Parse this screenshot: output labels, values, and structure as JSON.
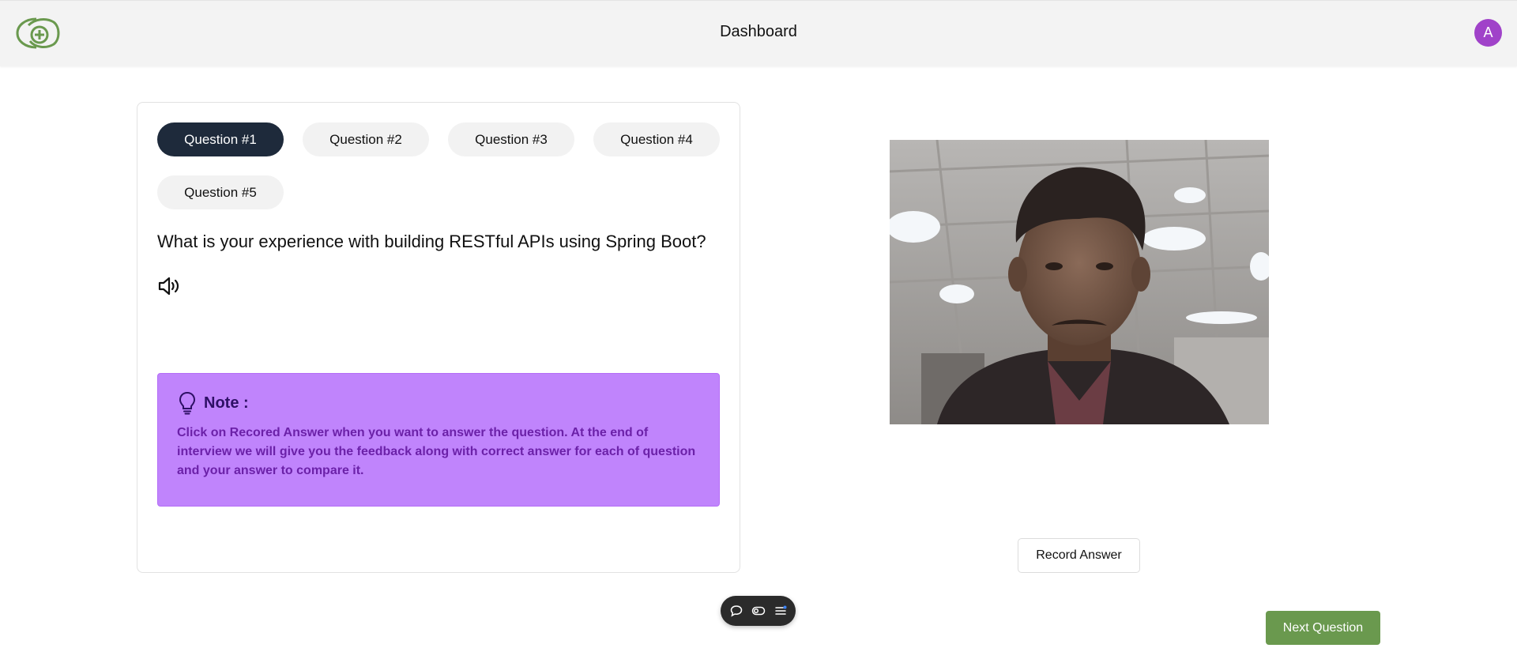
{
  "header": {
    "title": "Dashboard",
    "avatar_initial": "A",
    "logo_icon": "brand-logo",
    "colors": {
      "logo": "#6a994e",
      "avatar": "#a042c9"
    }
  },
  "question_tabs": [
    {
      "label": "Question #1",
      "active": true
    },
    {
      "label": "Question #2",
      "active": false
    },
    {
      "label": "Question #3",
      "active": false
    },
    {
      "label": "Question #4",
      "active": false
    },
    {
      "label": "Question #5",
      "active": false
    }
  ],
  "question": {
    "text": "What is your experience with building RESTful APIs using Spring Boot?",
    "speaker_icon": "volume-icon"
  },
  "note": {
    "title": "Note :",
    "icon": "lightbulb-icon",
    "body": "Click on Recored Answer when you want to answer the question. At the end of interview we will give you the feedback along with correct answer for each of question and your answer to compare it.",
    "colors": {
      "background": "#c084fc",
      "title": "#2e1065",
      "body": "#6b21a8"
    }
  },
  "webcam": {
    "icon": "webcam-feed"
  },
  "actions": {
    "record_label": "Record Answer",
    "next_label": "Next Question",
    "next_color": "#6a994e",
    "active_tab_color": "#1e2a3b"
  },
  "floating_toolbar": {
    "icons": [
      "comment-icon",
      "toggle-icon",
      "menu-icon"
    ]
  }
}
